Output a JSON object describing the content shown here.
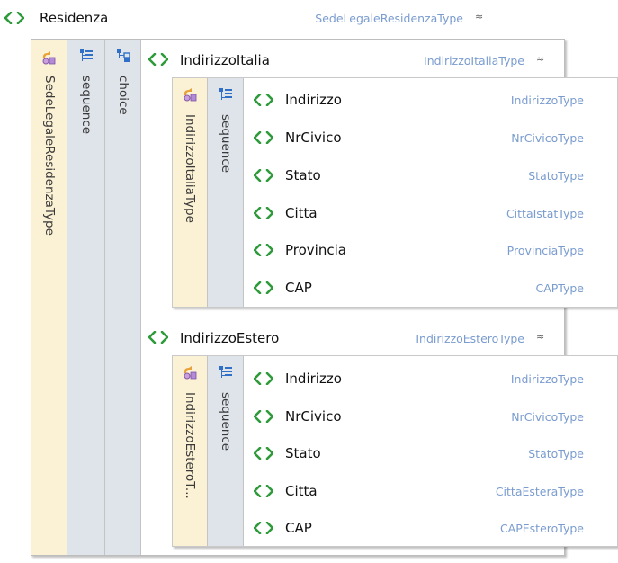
{
  "root": {
    "name": "Residenza",
    "type": "SedeLegaleResidenzaType",
    "collapse_glyph": "≈"
  },
  "outer_strips": {
    "type_label": "SedeLegaleResidenzaType",
    "sequence_label": "sequence",
    "choice_label": "choice"
  },
  "italia": {
    "name": "IndirizzoItalia",
    "type": "IndirizzoItaliaType",
    "collapse_glyph": "≈",
    "type_strip_label": "IndirizzoItaliaType",
    "sequence_label": "sequence",
    "children": [
      {
        "name": "Indirizzo",
        "type": "IndirizzoType"
      },
      {
        "name": "NrCivico",
        "type": "NrCivicoType"
      },
      {
        "name": "Stato",
        "type": "StatoType"
      },
      {
        "name": "Citta",
        "type": "CittaIstatType"
      },
      {
        "name": "Provincia",
        "type": "ProvinciaType"
      },
      {
        "name": "CAP",
        "type": "CAPType"
      }
    ]
  },
  "estero": {
    "name": "IndirizzoEstero",
    "type": "IndirizzoEsteroType",
    "collapse_glyph": "≈",
    "type_strip_label": "IndirizzoEsteroT...",
    "sequence_label": "sequence",
    "children": [
      {
        "name": "Indirizzo",
        "type": "IndirizzoType"
      },
      {
        "name": "NrCivico",
        "type": "NrCivicoType"
      },
      {
        "name": "Stato",
        "type": "StatoType"
      },
      {
        "name": "Citta",
        "type": "CittaEsteraType"
      },
      {
        "name": "CAP",
        "type": "CAPEsteroType"
      }
    ]
  },
  "colors": {
    "element_icon": "#2e9a3a",
    "type_text": "#7a9ccf",
    "type_strip": "#fbf1d4",
    "sequence_strip": "#dfe3ea",
    "sequence_icon": "#2f6fc8"
  },
  "icons": {
    "element": "element-brackets-icon",
    "complex_type": "complex-type-icon",
    "sequence": "sequence-icon",
    "choice": "choice-icon",
    "collapse": "collapse-chevron-icon"
  }
}
